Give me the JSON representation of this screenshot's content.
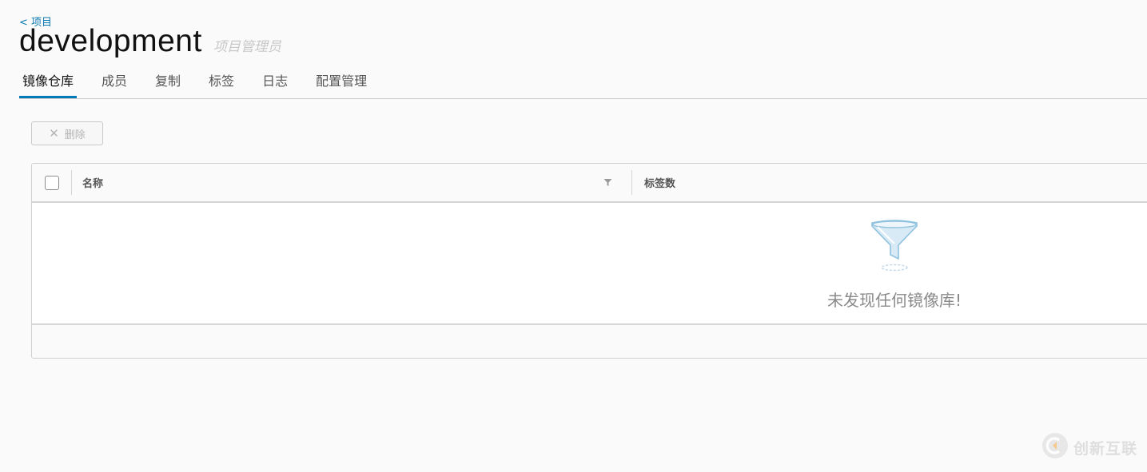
{
  "breadcrumb": {
    "label": "< 项目"
  },
  "header": {
    "title": "development",
    "role": "项目管理员"
  },
  "tabs": [
    {
      "label": "镜像仓库",
      "active": true
    },
    {
      "label": "成员"
    },
    {
      "label": "复制"
    },
    {
      "label": "标签"
    },
    {
      "label": "日志"
    },
    {
      "label": "配置管理"
    }
  ],
  "toolbar": {
    "delete_label": "删除",
    "delete_enabled": false
  },
  "grid": {
    "columns": [
      {
        "label": "名称"
      },
      {
        "label": "标签数"
      }
    ],
    "rows": [],
    "empty_message": "未发现任何镜像库!"
  },
  "watermark": {
    "text": "创新互联"
  },
  "colors": {
    "accent": "#0079b8",
    "link": "#0a79b3",
    "background": "#fafafa"
  }
}
